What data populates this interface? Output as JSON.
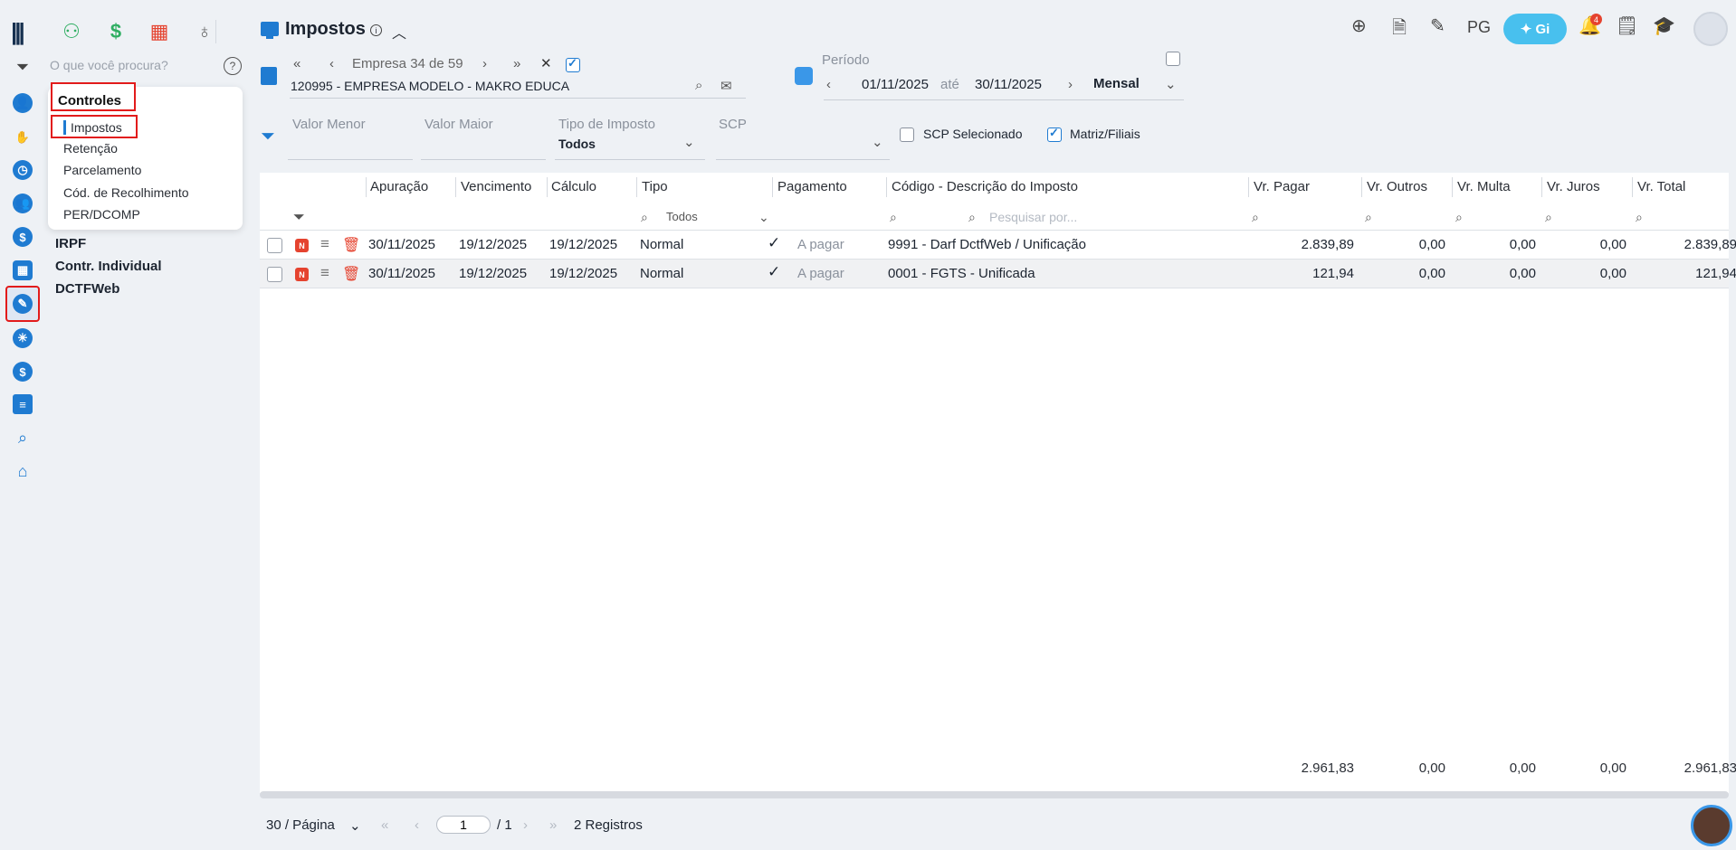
{
  "app": {
    "rail_icons": [
      "logo-icon",
      "filter-icon",
      "client-icon",
      "handshake-icon",
      "clock-icon",
      "people-icon",
      "dollar-icon",
      "calculator-icon",
      "tax-controls-icon",
      "network-icon",
      "money-bag-icon",
      "layers-icon",
      "search-icon",
      "home-icon"
    ]
  },
  "topbar": {
    "apps": [
      "people-icon",
      "dollar-icon",
      "grid-icon",
      "money-bag-icon"
    ],
    "right": {
      "pg_label": "PG",
      "gi_label": "Gi",
      "notif_count": "4"
    }
  },
  "menu": {
    "search_placeholder": "O que você procura?",
    "section": "Controles",
    "items": [
      "Impostos",
      "Retenção",
      "Parcelamento",
      "Cód. de Recolhimento",
      "PER/DCOMP"
    ],
    "groups": [
      "IRPF",
      "Contr. Individual",
      "DCTFWeb"
    ]
  },
  "header": {
    "title": "Impostos"
  },
  "empresa": {
    "nav_label": "Empresa 34 de 59",
    "selected": "120995 - EMPRESA MODELO - MAKRO EDUCA"
  },
  "periodo": {
    "label": "Período",
    "start": "01/11/2025",
    "ate": "até",
    "end": "30/11/2025",
    "freq": "Mensal"
  },
  "filters": {
    "valor_menor": "Valor Menor",
    "valor_maior": "Valor Maior",
    "tipo_imposto_label": "Tipo de Imposto",
    "tipo_imposto_value": "Todos",
    "scp_label": "SCP",
    "scp_selecionado": "SCP Selecionado",
    "matriz_filiais": "Matriz/Filiais"
  },
  "table": {
    "headers": {
      "apuracao": "Apuração",
      "vencimento": "Vencimento",
      "calculo": "Cálculo",
      "tipo": "Tipo",
      "pagamento": "Pagamento",
      "codigo": "Código - Descrição do Imposto",
      "vr_pagar": "Vr. Pagar",
      "vr_outros": "Vr. Outros",
      "vr_multa": "Vr. Multa",
      "vr_juros": "Vr. Juros",
      "vr_total": "Vr. Total"
    },
    "tipo_filter": "Todos",
    "search_placeholder": "Pesquisar por...",
    "rows": [
      {
        "badge": "N",
        "apuracao": "30/11/2025",
        "vencimento": "19/12/2025",
        "calculo": "19/12/2025",
        "tipo": "Normal",
        "pagamento": "A pagar",
        "codigo": "9991 - Darf DctfWeb / Unificação",
        "vr_pagar": "2.839,89",
        "vr_outros": "0,00",
        "vr_multa": "0,00",
        "vr_juros": "0,00",
        "vr_total": "2.839,89"
      },
      {
        "badge": "N",
        "apuracao": "30/11/2025",
        "vencimento": "19/12/2025",
        "calculo": "19/12/2025",
        "tipo": "Normal",
        "pagamento": "A pagar",
        "codigo": "0001 - FGTS - Unificada",
        "vr_pagar": "121,94",
        "vr_outros": "0,00",
        "vr_multa": "0,00",
        "vr_juros": "0,00",
        "vr_total": "121,94"
      }
    ],
    "totals": {
      "vr_pagar": "2.961,83",
      "vr_outros": "0,00",
      "vr_multa": "0,00",
      "vr_juros": "0,00",
      "vr_total": "2.961,83"
    }
  },
  "pager": {
    "per_page": "30 / Página",
    "page": "1",
    "of": "/ 1",
    "records": "2 Registros"
  },
  "colors": {
    "accent": "#1f7bd1",
    "danger": "#e5432f",
    "highlight": "#e21b1b",
    "gi": "#48c0ee"
  }
}
